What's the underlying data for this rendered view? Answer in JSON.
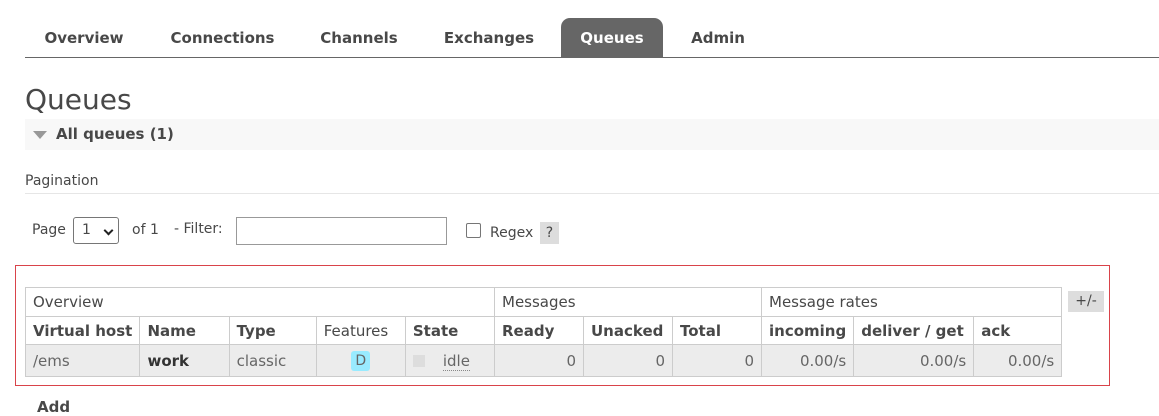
{
  "tabs": [
    "Overview",
    "Connections",
    "Channels",
    "Exchanges",
    "Queues",
    "Admin"
  ],
  "active_tab": "Queues",
  "page_title": "Queues",
  "section": {
    "title": "All queues (1)"
  },
  "pagination": {
    "heading": "Pagination",
    "page_label": "Page",
    "page_value": "1",
    "of_label": "of 1",
    "filter_label": "- Filter:",
    "filter_value": "",
    "regex_label": "Regex",
    "help_label": "?"
  },
  "table": {
    "groups": [
      "Overview",
      "Messages",
      "Message rates"
    ],
    "columns": [
      "Virtual host",
      "Name",
      "Type",
      "Features",
      "State",
      "Ready",
      "Unacked",
      "Total",
      "incoming",
      "deliver / get",
      "ack"
    ],
    "rows": [
      {
        "vhost": "/ems",
        "name": "work",
        "type": "classic",
        "feature": "D",
        "state": "idle",
        "ready": "0",
        "unacked": "0",
        "total": "0",
        "incoming": "",
        "deliver_get": "0.00/s",
        "ack": "0.00/s",
        "incoming_rate": "0.00/s"
      }
    ],
    "plus_minus": "+/-"
  },
  "add_section_peek": "Add",
  "colors": {
    "active_tab_bg": "#666666",
    "highlight_border": "#d9434a",
    "feature_badge": "#99ebff"
  },
  "icons": {
    "section_toggle": "triangle-down-icon",
    "select_chevron": "chevron-down-icon"
  }
}
